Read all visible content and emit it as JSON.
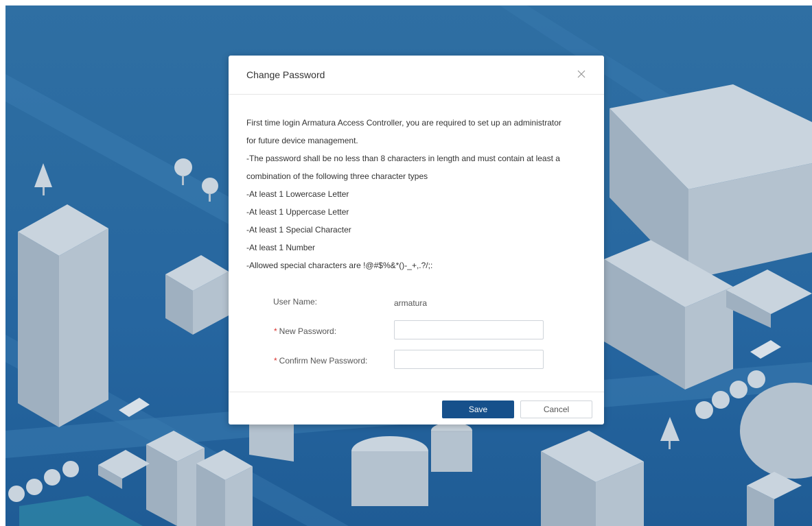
{
  "dialog": {
    "title": "Change Password",
    "close_icon": "close-icon",
    "info_lines": [
      "First time login Armatura Access Controller, you are required to set up an administrator",
      "for future device management.",
      "-The password shall be no less than 8 characters in length and must contain at least a",
      "combination of the following three character types",
      "-At least 1 Lowercase Letter",
      "-At least 1 Uppercase Letter",
      "-At least 1 Special Character",
      "-At least 1 Number",
      "-Allowed special characters are !@#$%&*()-_+,.?/;:"
    ],
    "form": {
      "username_label": "User Name:",
      "username_value": "armatura",
      "required_mark": "*",
      "new_password_label": "New Password:",
      "new_password_value": "",
      "confirm_password_label": "Confirm New Password:",
      "confirm_password_value": ""
    },
    "footer": {
      "save_label": "Save",
      "cancel_label": "Cancel"
    }
  },
  "colors": {
    "background": "#2a6aa0",
    "primary_button": "#16508b",
    "required": "#d9322e"
  }
}
